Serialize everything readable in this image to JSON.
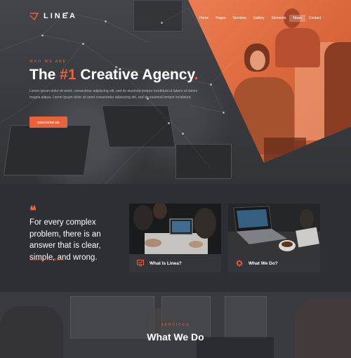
{
  "brand": {
    "name": "LINEA",
    "accent": "#e8633a"
  },
  "nav": {
    "items": [
      "Home",
      "Pages",
      "Services",
      "Gallery",
      "Elements",
      "News",
      "Contact"
    ],
    "active_index": 5
  },
  "hero": {
    "eyebrow": "WHO WE ARE",
    "title_prefix": "The ",
    "title_accent": "#1",
    "title_suffix": " Creative Agency",
    "description": "Lorem ipsum dolor sit amet, consectetur adipiscing elit, sed do eiusmod tempor incididunt ut labore et dolore magna aliqua. Lorem ipsum dolor sit amet consectetur adipiscing elit, sed do eiusmod tempor incididunt.",
    "button_label": "DISCOVER US"
  },
  "quote": {
    "mark": "❝",
    "text": "For every complex problem, there is an answer that is clear, simple, and wrong.",
    "author": "Words by H. L. Mencken"
  },
  "cards": [
    {
      "label": "What Is Linea?",
      "icon": "presentation-icon"
    },
    {
      "label": "What We Do?",
      "icon": "gear-icon"
    }
  ],
  "services": {
    "eyebrow": "SERVICES",
    "title": "What We Do"
  }
}
